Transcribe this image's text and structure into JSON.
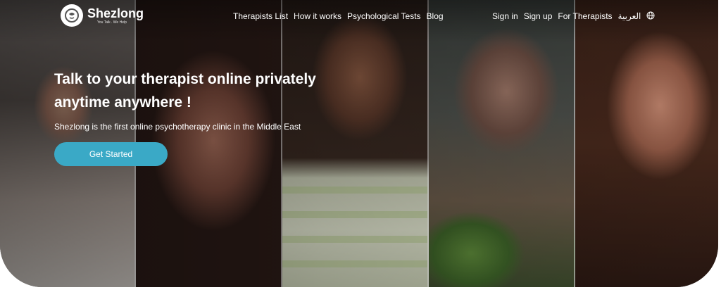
{
  "brand": {
    "name": "Shezlong",
    "tagline": "You Talk . We Help"
  },
  "nav": {
    "left": [
      "Therapists List",
      "How it works",
      "Psychological Tests",
      "Blog"
    ],
    "right": [
      "Sign in",
      "Sign up",
      "For Therapists",
      "العربية"
    ]
  },
  "icons": {
    "language": "globe-icon",
    "logo": "chat-bubble-logo-icon"
  },
  "hero": {
    "headline": "Talk to your therapist online privately anytime anywhere !",
    "subtitle": "Shezlong is the first online psychotherapy clinic in the Middle East",
    "cta_label": "Get Started"
  },
  "colors": {
    "accent": "#3aa9c6",
    "text": "#ffffff"
  }
}
